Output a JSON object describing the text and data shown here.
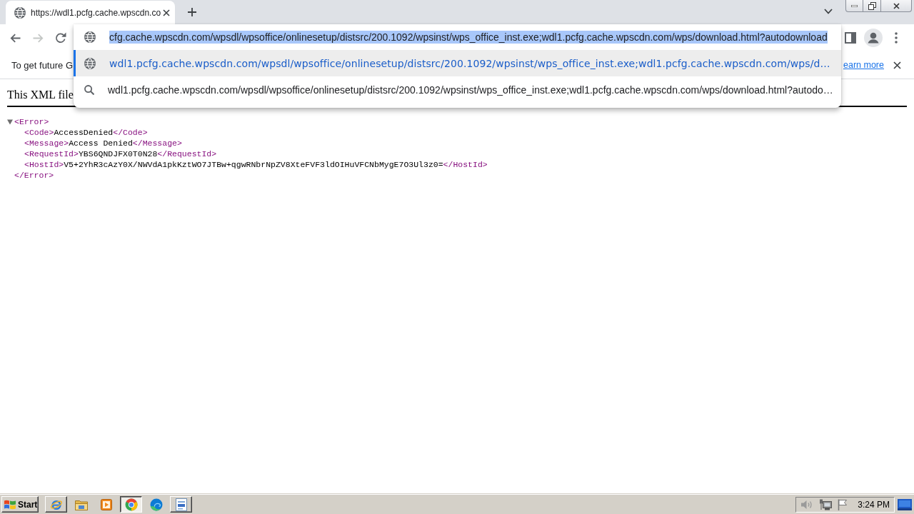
{
  "tabs": [
    {
      "title": "https://wdl1.pcfg.cache.wpscdn.co",
      "selected": true
    }
  ],
  "nav_buttons": [
    {
      "kind": "back",
      "disabled": false
    },
    {
      "kind": "forward",
      "disabled": true
    },
    {
      "kind": "reload",
      "disabled": false
    }
  ],
  "omnibox": {
    "value": "cfg.cache.wpscdn.com/wpsdl/wpsoffice/onlinesetup/distsrc/200.1092/wpsinst/wps_office_inst.exe;wdl1.pcfg.cache.wpscdn.com/wps/download.html?autodownload",
    "highlighted": true
  },
  "suggestions": [
    {
      "kind": "url",
      "text": "wdl1.pcfg.cache.wpscdn.com/wpsdl/wpsoffice/onlinesetup/distsrc/200.1092/wpsinst/wps_office_inst.exe;wdl1.pcfg.cache.wpscdn.com/wps/d…",
      "selected": true
    },
    {
      "kind": "search",
      "text": "wdl1.pcfg.cache.wpscdn.com/wpsdl/wpsoffice/onlinesetup/distsrc/200.1092/wpsinst/wps_office_inst.exe;wdl1.pcfg.cache.wpscdn.com/wps/download.html?autodo…",
      "selected": false
    }
  ],
  "infobar": {
    "text": "To get future G",
    "link": "earn more"
  },
  "document": {
    "header": "This XML file",
    "xml": {
      "open": "<Error>",
      "close": "</Error>",
      "expanded": true,
      "children": [
        {
          "open": "<Code>",
          "text": "AccessDenied",
          "close": "</Code>"
        },
        {
          "open": "<Message>",
          "text": "Access Denied",
          "close": "</Message>"
        },
        {
          "open": "<RequestId>",
          "text": "YBS6QNDJFX0T0N28",
          "close": "</RequestId>"
        },
        {
          "open": "<HostId>",
          "text": "V5+2YhR3cAzY0X/NWVdA1pkKztWO7JTBw+qgwRNbrNpZV8XteFVF3ldOIHuVFCNbMygE7O3Ul3z0=",
          "close": "</HostId>"
        }
      ]
    }
  },
  "taskbar": {
    "start": "Start",
    "apps": [
      {
        "kind": "ie",
        "running": true,
        "selected": false
      },
      {
        "kind": "folder",
        "running": false,
        "selected": false
      },
      {
        "kind": "media",
        "running": false,
        "selected": false
      },
      {
        "kind": "chrome",
        "running": true,
        "selected": true
      },
      {
        "kind": "edge",
        "running": false,
        "selected": false
      },
      {
        "kind": "document",
        "running": true,
        "selected": false
      }
    ],
    "clock": "3:24 PM"
  }
}
